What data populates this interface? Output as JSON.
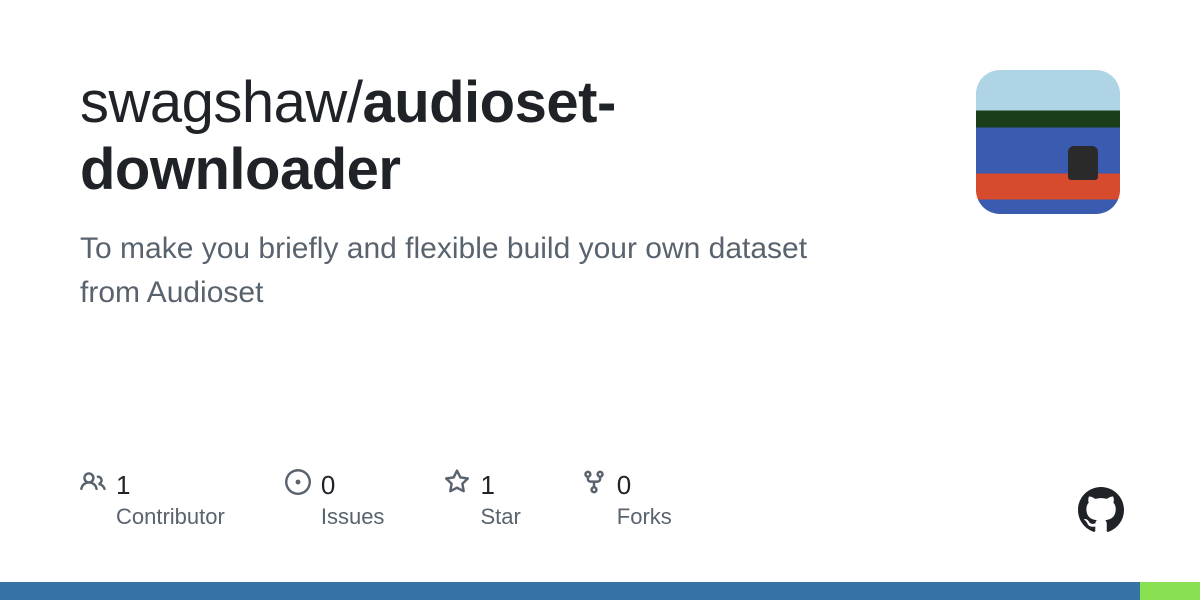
{
  "repo": {
    "owner": "swagshaw",
    "slash": "/",
    "name_bold": "audioset",
    "name_rest": "-downloader",
    "description": "To make you briefly and flexible build your own dataset from Audioset"
  },
  "stats": {
    "contributors": {
      "count": "1",
      "label": "Contributor"
    },
    "issues": {
      "count": "0",
      "label": "Issues"
    },
    "stars": {
      "count": "1",
      "label": "Star"
    },
    "forks": {
      "count": "0",
      "label": "Forks"
    }
  },
  "languages": [
    {
      "color": "#3572A5",
      "percent": 95
    },
    {
      "color": "#89e051",
      "percent": 5
    }
  ]
}
